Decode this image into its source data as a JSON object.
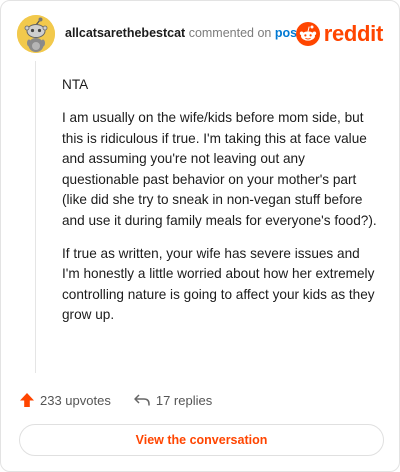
{
  "header": {
    "username": "allcatsarethebestcat",
    "action_text": "commented on",
    "post_link": "post",
    "logo_text": "reddit"
  },
  "comment": {
    "paragraphs": [
      "NTA",
      "I am usually on the wife/kids before mom side, but this is ridiculous if true. I'm taking this at face value and assuming you're not leaving out any questionable past behavior on your mother's part (like did she try to sneak in non-vegan stuff before and use it during family meals for everyone's food?).",
      "If true as written, your wife has severe issues and I'm honestly a little worried about how her extremely controlling nature is going to affect your kids as they grow up."
    ]
  },
  "footer": {
    "upvotes": "233 upvotes",
    "replies": "17 replies",
    "cta_label": "View the conversation"
  },
  "colors": {
    "accent": "#ff4500",
    "link": "#0079d3",
    "avatar_bg": "#f2c94c"
  },
  "icons": [
    "snoo-avatar",
    "reddit-logo-icon",
    "upvote-arrow-icon",
    "reply-arrow-icon"
  ]
}
